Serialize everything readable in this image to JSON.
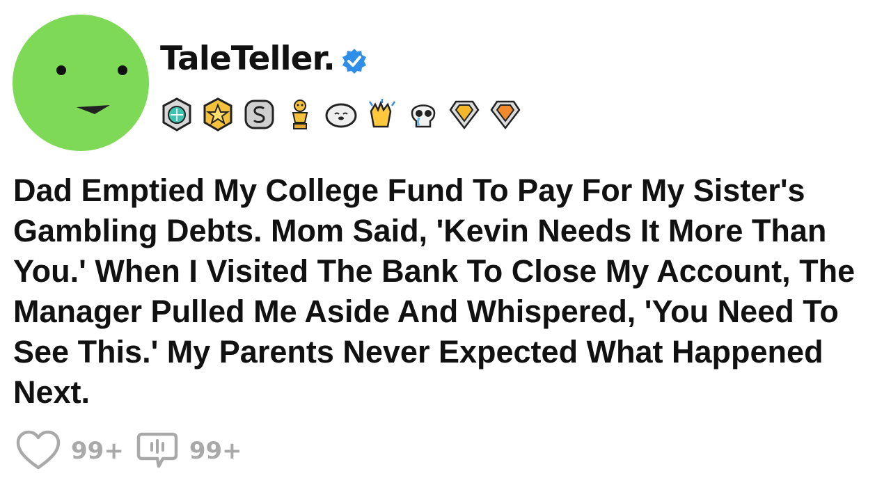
{
  "user": {
    "avatar_icon": "smiley-face-icon",
    "avatar_color": "#7ed957",
    "name": "TaleTeller.",
    "verified_icon": "verified-badge-icon",
    "verified_color": "#2f8fe8"
  },
  "badges": [
    "silver-gem-award-icon",
    "gold-star-award-icon",
    "silver-s-award-icon",
    "gold-trophy-award-icon",
    "seal-award-icon",
    "clapping-hands-award-icon",
    "crying-skull-award-icon",
    "gold-gem-shield-award-icon",
    "orange-gem-shield-award-icon"
  ],
  "post": {
    "title": "Dad Emptied My College Fund To Pay For My Sister's Gambling Debts. Mom Said, 'Kevin Needs It More Than You.' When I Visited The Bank To Close My Account, The Manager Pulled Me Aside And Whispered, 'You Need To See This.' My Parents Never Expected What Happened Next."
  },
  "actions": {
    "like_icon": "heart-icon",
    "like_count": "99+",
    "comment_icon": "comment-icon",
    "comment_count": "99+"
  }
}
